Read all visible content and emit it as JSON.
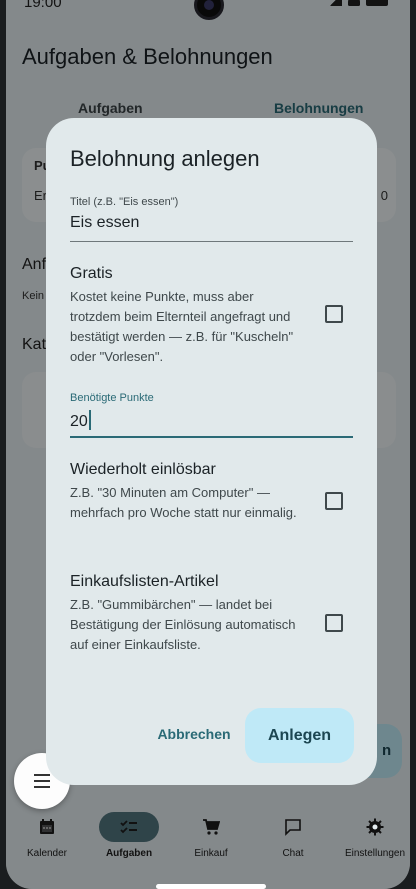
{
  "status": {
    "time": "19:00"
  },
  "app": {
    "title": "Aufgaben & Belohnungen",
    "tabs": [
      {
        "label": "Aufgaben"
      },
      {
        "label": "Belohnungen",
        "selected": true
      }
    ],
    "background": {
      "card1_heading": "Pu",
      "card1_text": "Er",
      "card1_value": "0",
      "section1_heading": "Anf",
      "section1_text": "Kein",
      "section2_heading": "Kat",
      "right_button_fragment": "n"
    }
  },
  "dialog": {
    "title": "Belohnung anlegen",
    "title_field": {
      "label": "Titel (z.B. \"Eis essen\")",
      "value": "Eis essen"
    },
    "gratis": {
      "title": "Gratis",
      "description": "Kostet keine Punkte, muss aber trotzdem beim Elternteil angefragt und bestätigt werden — z.B. für \"Kuscheln\" oder \"Vorlesen\".",
      "checked": false
    },
    "points_field": {
      "label": "Benötigte Punkte",
      "value": "20"
    },
    "repeat": {
      "title": "Wiederholt einlösbar",
      "description": "Z.B. \"30 Minuten am Computer\" — mehrfach pro Woche statt nur einmalig.",
      "checked": false
    },
    "shopping": {
      "title": "Einkaufslisten-Artikel",
      "description": "Z.B. \"Gummibärchen\" — landet bei Bestätigung der Einlösung automatisch auf einer Einkaufsliste.",
      "checked": false
    },
    "cancel_label": "Abbrechen",
    "create_label": "Anlegen"
  },
  "bottom_nav": [
    {
      "label": "Kalender",
      "icon": "calendar-icon"
    },
    {
      "label": "Aufgaben",
      "icon": "checklist-icon",
      "active": true
    },
    {
      "label": "Einkauf",
      "icon": "cart-icon"
    },
    {
      "label": "Chat",
      "icon": "chat-icon"
    },
    {
      "label": "Einstellungen",
      "icon": "gear-icon"
    }
  ],
  "colors": {
    "accent": "#2a6a76",
    "primary_button": "#bfe9f7",
    "dialog_surface": "#e1e9eb"
  }
}
